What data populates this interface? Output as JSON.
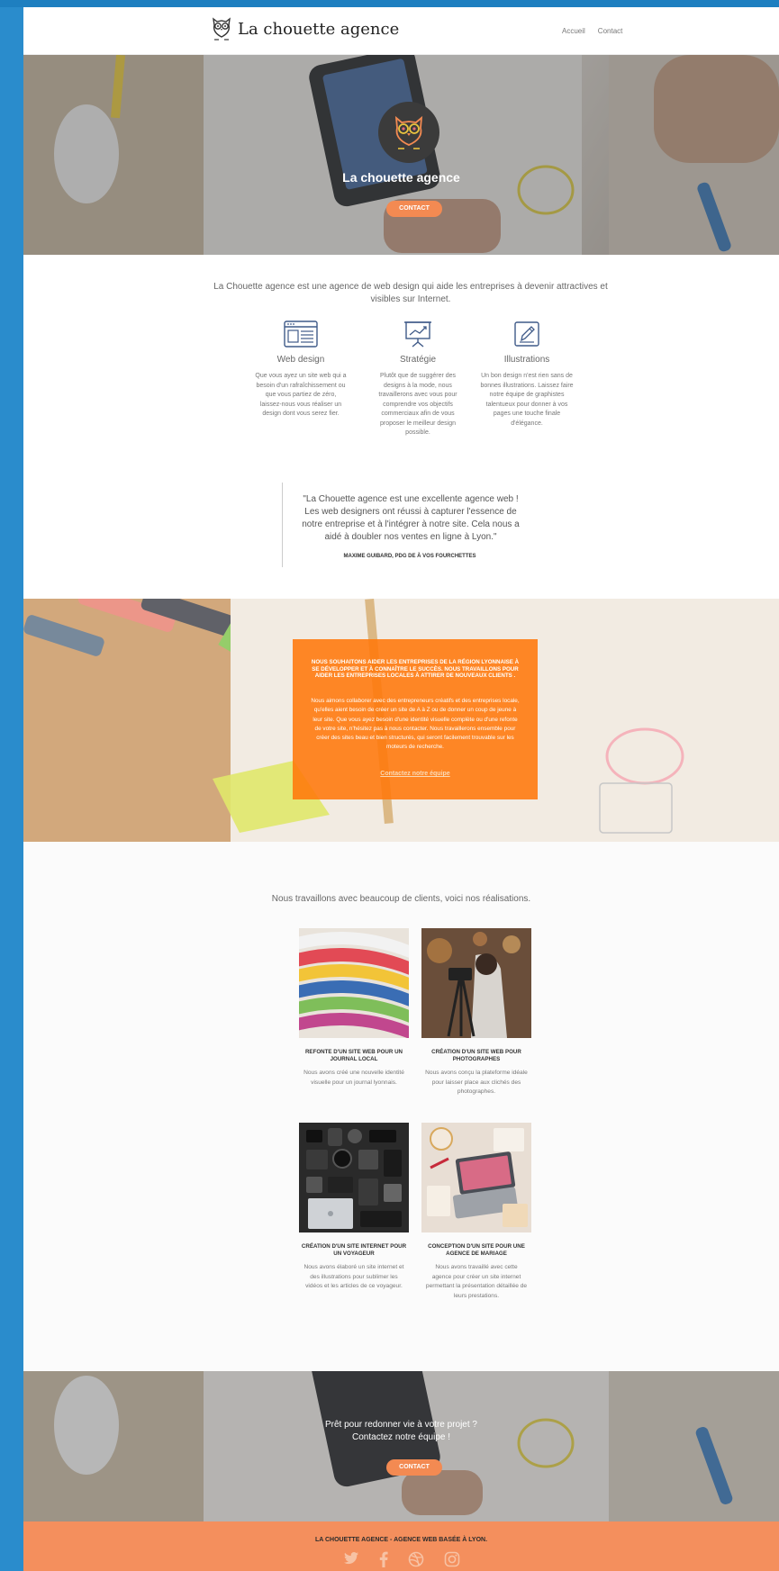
{
  "header": {
    "logo_text": "La chouette agence",
    "nav": [
      {
        "label": "Accueil"
      },
      {
        "label": "Contact"
      }
    ]
  },
  "hero": {
    "title": "La chouette agence",
    "button_label": "CONTACT"
  },
  "intro": {
    "text": "La Chouette agence est une agence de web design qui aide les entreprises à devenir attractives et visibles sur Internet."
  },
  "services": [
    {
      "icon": "browser-window-icon",
      "title": "Web design",
      "description": "Que vous ayez un site web qui a besoin d'un rafraîchissement ou que vous partiez de zéro, laissez-nous vous réaliser un design dont vous serez fier."
    },
    {
      "icon": "presentation-chart-icon",
      "title": "Stratégie",
      "description": "Plutôt que de suggérer des designs à la mode, nous travaillerons avec vous pour comprendre vos objectifs commerciaux afin de vous proposer le meilleur design possible."
    },
    {
      "icon": "pencil-edit-icon",
      "title": "Illustrations",
      "description": "Un bon design n'est rien sans de bonnes illustrations. Laissez faire notre équipe de graphistes talentueux pour donner à vos pages une touche finale d'élégance."
    }
  ],
  "testimonial": {
    "quote": "\"La Chouette agence est une excellente agence web ! Les web designers ont réussi à capturer l'essence de notre entreprise et à l'intégrer à notre site. Cela nous a aidé à doubler nos ventes en ligne à Lyon.\"",
    "author": "MAXIME GUIBARD, PDG DE À VOS FOURCHETTES"
  },
  "mission": {
    "heading": "NOUS SOUHAITONS AIDER LES ENTREPRISES DE LA RÉGION LYONNAISE À SE DÉVELOPPER ET À CONNAÎTRE LE SUCCÈS. NOUS TRAVAILLONS POUR AIDER LES ENTREPRISES LOCALES À ATTIRER DE NOUVEAUX CLIENTS .",
    "body": "Nous aimons collaborer avec des entrepreneurs créatifs et des entreprises locale, qu'elles aient besoin de créer un site de A à Z ou de donner un coup de jeune à leur site. Que vous ayez besoin d'une identité visuelle complète ou d'une refonte de votre site, n'hésitez pas à nous contacter. Nous travaillerons ensemble pour créer des sites beau et bien structurés, qui seront facilement trouvable sur les moteurs de recherche.",
    "link": "Contactez notre équipe"
  },
  "works": {
    "intro": "Nous travaillons avec beaucoup de clients, voici nos réalisations.",
    "items": [
      {
        "title": "REFONTE D'UN SITE WEB POUR UN JOURNAL LOCAL",
        "description": "Nous avons créé une nouvelle identité visuelle pour un journal lyonnais."
      },
      {
        "title": "CRÉATION D'UN SITE WEB POUR PHOTOGRAPHES",
        "description": "Nous avons conçu la plateforme idéale pour laisser place aux clichés des photographes."
      },
      {
        "title": "CRÉATION D'UN SITE INTERNET POUR UN VOYAGEUR",
        "description": "Nous avons élaboré un site internet et des illustrations pour sublimer les vidéos et les articles de ce voyageur."
      },
      {
        "title": "CONCEPTION D'UN SITE POUR UNE AGENCE DE MARIAGE",
        "description": "Nous avons travaillé avec cette agence pour créer un site internet permettant la présentation détaillée de leurs prestations."
      }
    ]
  },
  "cta": {
    "line1": "Prêt pour redonner vie à votre projet ?",
    "line2": "Contactez notre équipe !",
    "button_label": "CONTACT"
  },
  "footer": {
    "text": "LA CHOUETTE AGENCE - AGENCE WEB BASÉE À LYON.",
    "socials": [
      "twitter-icon",
      "facebook-icon",
      "dribbble-icon",
      "instagram-icon"
    ]
  },
  "colors": {
    "accent": "#f38a52",
    "mission_box": "#ff780a",
    "footer": "#f48f5d"
  }
}
